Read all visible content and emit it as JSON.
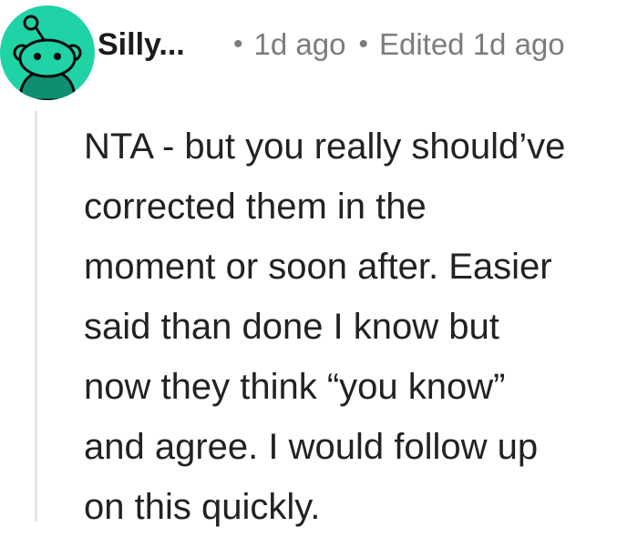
{
  "comment": {
    "author": "Silly...",
    "separator": "•",
    "time_ago": "1d ago",
    "edited_label": "Edited 1d ago",
    "body_lines": [
      "NTA - but you really should’ve",
      "corrected them in the",
      "moment or soon after. Easier",
      "said than done I know but",
      "now they think “you know”",
      "and agree. I would follow up",
      "on this quickly."
    ]
  },
  "colors": {
    "avatar_bg": "#1fd3a6",
    "text": "#222222",
    "meta_text": "#7c7c7c",
    "thread_line": "#e6e6e6"
  },
  "icons": {
    "avatar": "snoo-avatar-icon"
  }
}
